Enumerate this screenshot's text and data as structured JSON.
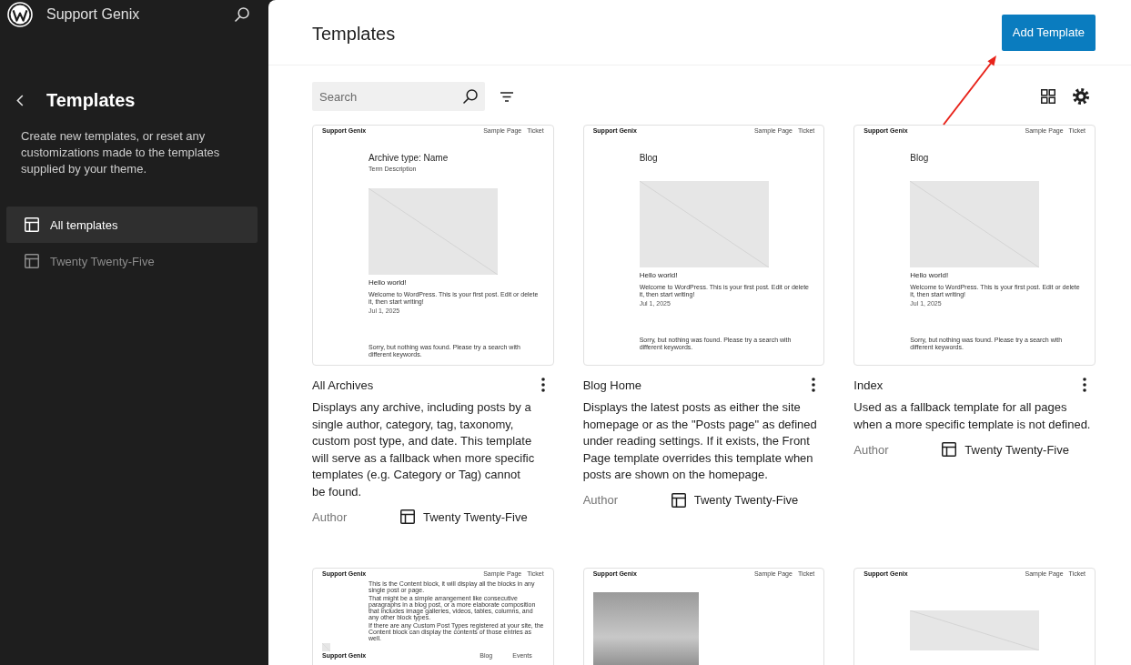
{
  "sidebar": {
    "site_title": "Support Genix",
    "title": "Templates",
    "description": "Create new templates, or reset any customizations made to the templates supplied by your theme.",
    "nav": [
      {
        "label": "All templates",
        "selected": true
      },
      {
        "label": "Twenty Twenty-Five",
        "selected": false
      }
    ]
  },
  "header": {
    "title": "Templates",
    "add_button": "Add Template"
  },
  "toolbar": {
    "search": {
      "placeholder": "Search"
    }
  },
  "templates": [
    {
      "title": "All Archives",
      "description": "Displays any archive, including posts by a single author, category, tag, taxonomy, custom post type, and date. This template will serve as a fallback when more specific templates (e.g. Category or Tag) cannot be found.",
      "author_label": "Author",
      "author": "Twenty Twenty-Five",
      "preview": {
        "header": {
          "site_title": "Support Genix",
          "nav": [
            "Sample Page",
            "Ticket"
          ]
        },
        "blocks": [
          {
            "kind": "heading",
            "text": "Archive type: Name"
          },
          {
            "kind": "caption",
            "text": "Term Description"
          },
          {
            "kind": "image"
          },
          {
            "kind": "post_title",
            "text": "Hello world!"
          },
          {
            "kind": "excerpt",
            "text": "Welcome to WordPress. This is your first post. Edit or delete it, then start writing!"
          },
          {
            "kind": "date",
            "text": "Jul 1, 2025"
          },
          {
            "kind": "notice",
            "text": "Sorry, but nothing was found. Please try a search with different keywords."
          }
        ]
      }
    },
    {
      "title": "Blog Home",
      "description": "Displays the latest posts as either the site homepage or as the \"Posts page\" as defined under reading settings. If it exists, the Front Page template overrides this template when posts are shown on the homepage.",
      "author_label": "Author",
      "author": "Twenty Twenty-Five",
      "preview": {
        "header": {
          "site_title": "Support Genix",
          "nav": [
            "Sample Page",
            "Ticket"
          ]
        },
        "blocks": [
          {
            "kind": "heading",
            "text": "Blog"
          },
          {
            "kind": "image"
          },
          {
            "kind": "post_title",
            "text": "Hello world!"
          },
          {
            "kind": "excerpt",
            "text": "Welcome to WordPress. This is your first post. Edit or delete it, then start writing!"
          },
          {
            "kind": "date",
            "text": "Jul 1, 2025"
          },
          {
            "kind": "notice",
            "text": "Sorry, but nothing was found. Please try a search with different keywords."
          }
        ]
      }
    },
    {
      "title": "Index",
      "description": "Used as a fallback template for all pages when a more specific template is not defined.",
      "author_label": "Author",
      "author": "Twenty Twenty-Five",
      "preview": {
        "header": {
          "site_title": "Support Genix",
          "nav": [
            "Sample Page",
            "Ticket"
          ]
        },
        "blocks": [
          {
            "kind": "heading",
            "text": "Blog"
          },
          {
            "kind": "image"
          },
          {
            "kind": "post_title",
            "text": "Hello world!"
          },
          {
            "kind": "excerpt",
            "text": "Welcome to WordPress. This is your first post. Edit or delete it, then start writing!"
          },
          {
            "kind": "date",
            "text": "Jul 1, 2025"
          },
          {
            "kind": "notice",
            "text": "Sorry, but nothing was found. Please try a search with different keywords."
          }
        ]
      }
    },
    {
      "preview": {
        "header": {
          "site_title": "Support Genix",
          "nav": [
            "Sample Page",
            "Ticket"
          ]
        },
        "blocks": [
          {
            "kind": "paragraph",
            "text": "This is the Content block, it will display all the blocks in any single post or page."
          },
          {
            "kind": "paragraph",
            "text": "That might be a simple arrangement like consecutive paragraphs in a blog post, or a more elaborate composition that includes image galleries, videos, tables, columns, and any other block types."
          },
          {
            "kind": "paragraph",
            "text": "If there are any Custom Post Types registered at your site, the Content block can display the contents of those entries as well."
          },
          {
            "kind": "footer",
            "site_title": "Support Genix",
            "nav": [
              "Blog",
              "Events"
            ]
          }
        ]
      }
    },
    {
      "preview": {
        "header": {
          "site_title": "Support Genix",
          "nav": [
            "Sample Page",
            "Ticket"
          ]
        },
        "blocks": [
          {
            "kind": "photo"
          }
        ]
      }
    },
    {
      "preview": {
        "header": {
          "site_title": "Support Genix",
          "nav": [
            "Sample Page",
            "Ticket"
          ]
        },
        "blocks": [
          {
            "kind": "banner"
          }
        ]
      }
    }
  ],
  "annotations": [
    {
      "kind": "arrow"
    }
  ]
}
